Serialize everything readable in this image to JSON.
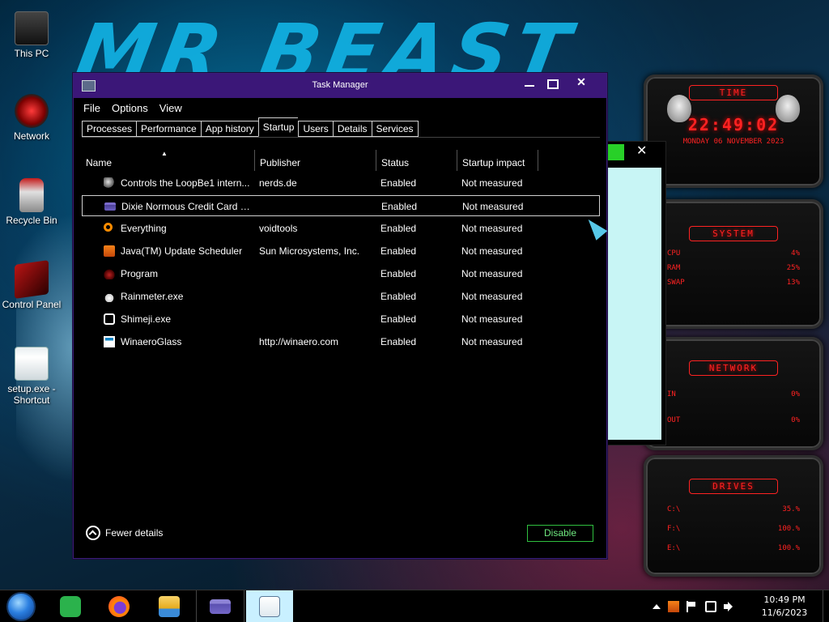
{
  "desktop": {
    "icons": [
      {
        "label": "This PC"
      },
      {
        "label": "Network"
      },
      {
        "label": "Recycle Bin"
      },
      {
        "label": "Control Panel"
      },
      {
        "label": "setup.exe - Shortcut"
      }
    ]
  },
  "rainmeter": {
    "time_title": "TIME",
    "time_value": "22:49:02",
    "date_value": "MONDAY 06 NOVEMBER 2023",
    "system_title": "SYSTEM",
    "system_rows": [
      {
        "label": "CPU",
        "value": "4%"
      },
      {
        "label": "RAM",
        "value": "25%"
      },
      {
        "label": "SWAP",
        "value": "13%"
      }
    ],
    "network_title": "NETWORK",
    "network_rows": [
      {
        "label": "IN",
        "value": "0%"
      },
      {
        "label": "OUT",
        "value": "0%"
      }
    ],
    "drives_title": "DRIVES",
    "drives_rows": [
      {
        "label": "C:\\",
        "value": "35.%"
      },
      {
        "label": "F:\\",
        "value": "100.%"
      },
      {
        "label": "E:\\",
        "value": "100.%"
      }
    ]
  },
  "taskmanager": {
    "title": "Task Manager",
    "menu": [
      "File",
      "Options",
      "View"
    ],
    "tabs": [
      "Processes",
      "Performance",
      "App history",
      "Startup",
      "Users",
      "Details",
      "Services"
    ],
    "active_tab": "Startup",
    "columns": [
      "Name",
      "Publisher",
      "Status",
      "Startup impact"
    ],
    "rows": [
      {
        "icon": "loopbe-icon",
        "name": "Controls the LoopBe1 intern...",
        "publisher": "nerds.de",
        "status": "Enabled",
        "impact": "Not measured"
      },
      {
        "icon": "card-icon",
        "name": "Dixie Normous Credit Card S...",
        "publisher": "",
        "status": "Enabled",
        "impact": "Not measured",
        "selected": true
      },
      {
        "icon": "everything-icon",
        "name": "Everything",
        "publisher": "voidtools",
        "status": "Enabled",
        "impact": "Not measured"
      },
      {
        "icon": "java-icon",
        "name": "Java(TM) Update Scheduler",
        "publisher": "Sun Microsystems, Inc.",
        "status": "Enabled",
        "impact": "Not measured"
      },
      {
        "icon": "program-icon",
        "name": "Program",
        "publisher": "",
        "status": "Enabled",
        "impact": "Not measured"
      },
      {
        "icon": "rainmeter-icon",
        "name": "Rainmeter.exe",
        "publisher": "",
        "status": "Enabled",
        "impact": "Not measured"
      },
      {
        "icon": "shimeji-icon",
        "name": "Shimeji.exe",
        "publisher": "",
        "status": "Enabled",
        "impact": "Not measured"
      },
      {
        "icon": "winaero-icon",
        "name": "WinaeroGlass",
        "publisher": "http://winaero.com",
        "status": "Enabled",
        "impact": "Not measured"
      }
    ],
    "fewer_details": "Fewer details",
    "disable_button": "Disable"
  },
  "taskbar": {
    "apps": [
      "start-orb",
      "feedly",
      "firefox",
      "file-explorer",
      "credit-card-app",
      "task-manager"
    ],
    "clock_time": "10:49 PM",
    "clock_date": "11/6/2023"
  }
}
